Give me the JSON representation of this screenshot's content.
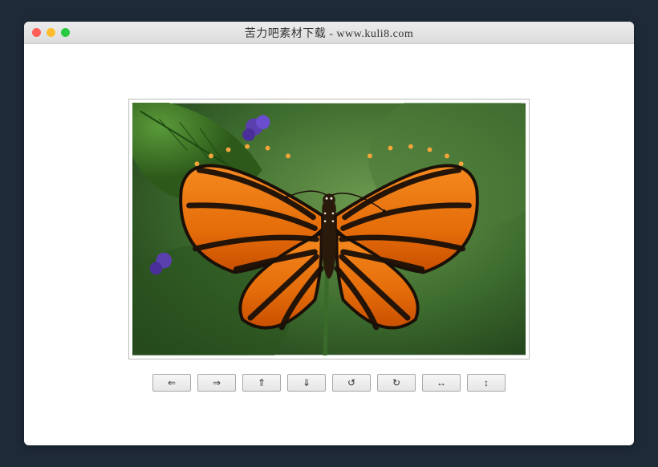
{
  "window": {
    "title": "苦力吧素材下载 - www.kuli8.com"
  },
  "image": {
    "description": "orange-black-striped-butterfly"
  },
  "toolbar": {
    "buttons": [
      {
        "name": "arrow-left-icon",
        "glyph": "⇐"
      },
      {
        "name": "arrow-right-icon",
        "glyph": "⇒"
      },
      {
        "name": "arrow-up-icon",
        "glyph": "⇑"
      },
      {
        "name": "arrow-down-icon",
        "glyph": "⇓"
      },
      {
        "name": "rotate-ccw-icon",
        "glyph": "↺"
      },
      {
        "name": "rotate-cw-icon",
        "glyph": "↻"
      },
      {
        "name": "flip-horizontal-icon",
        "glyph": "↔"
      },
      {
        "name": "flip-vertical-icon",
        "glyph": "↕"
      }
    ]
  }
}
